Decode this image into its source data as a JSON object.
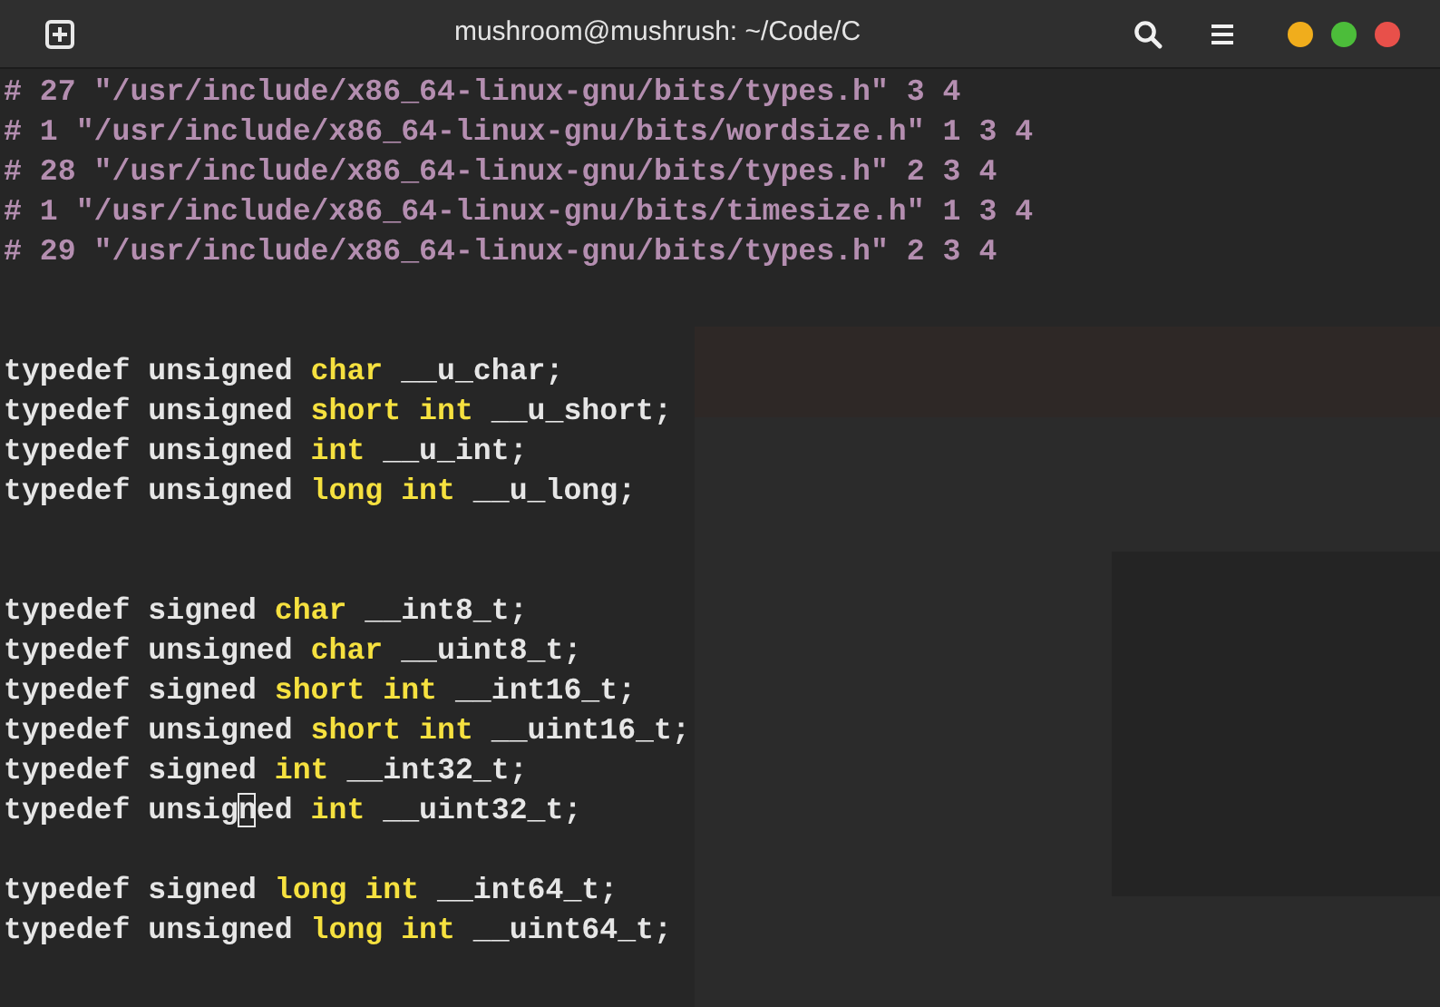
{
  "window": {
    "title": "mushroom@mushrush: ~/Code/C"
  },
  "window_controls": [
    {
      "color": "#f0ad1c"
    },
    {
      "color": "#4cbd3a"
    },
    {
      "color": "#e8504a"
    }
  ],
  "terminal": {
    "lines": [
      {
        "kind": "code",
        "segments": [
          {
            "kind": "directive",
            "text": "# 27 \"/usr/include/x86_64-linux-gnu/bits/types.h\" 3 4"
          }
        ]
      },
      {
        "kind": "code",
        "segments": [
          {
            "kind": "directive",
            "text": "# 1 \"/usr/include/x86_64-linux-gnu/bits/wordsize.h\" 1 3 4"
          }
        ]
      },
      {
        "kind": "code",
        "segments": [
          {
            "kind": "directive",
            "text": "# 28 \"/usr/include/x86_64-linux-gnu/bits/types.h\" 2 3 4"
          }
        ]
      },
      {
        "kind": "code",
        "segments": [
          {
            "kind": "directive",
            "text": "# 1 \"/usr/include/x86_64-linux-gnu/bits/timesize.h\" 1 3 4"
          }
        ]
      },
      {
        "kind": "code",
        "segments": [
          {
            "kind": "directive",
            "text": "# 29 \"/usr/include/x86_64-linux-gnu/bits/types.h\" 2 3 4"
          }
        ]
      },
      {
        "kind": "blank"
      },
      {
        "kind": "blank"
      },
      {
        "kind": "code",
        "segments": [
          {
            "kind": "plain",
            "text": "typedef unsigned "
          },
          {
            "kind": "type",
            "text": "char"
          },
          {
            "kind": "plain",
            "text": " __u_char;"
          }
        ]
      },
      {
        "kind": "code",
        "segments": [
          {
            "kind": "plain",
            "text": "typedef unsigned "
          },
          {
            "kind": "type",
            "text": "short int"
          },
          {
            "kind": "plain",
            "text": " __u_short;"
          }
        ]
      },
      {
        "kind": "code",
        "segments": [
          {
            "kind": "plain",
            "text": "typedef unsigned "
          },
          {
            "kind": "type",
            "text": "int"
          },
          {
            "kind": "plain",
            "text": " __u_int;"
          }
        ]
      },
      {
        "kind": "code",
        "segments": [
          {
            "kind": "plain",
            "text": "typedef unsigned "
          },
          {
            "kind": "type",
            "text": "long int"
          },
          {
            "kind": "plain",
            "text": " __u_long;"
          }
        ]
      },
      {
        "kind": "blank"
      },
      {
        "kind": "blank"
      },
      {
        "kind": "code",
        "segments": [
          {
            "kind": "plain",
            "text": "typedef signed "
          },
          {
            "kind": "type",
            "text": "char"
          },
          {
            "kind": "plain",
            "text": " __int8_t;"
          }
        ]
      },
      {
        "kind": "code",
        "segments": [
          {
            "kind": "plain",
            "text": "typedef unsigned "
          },
          {
            "kind": "type",
            "text": "char"
          },
          {
            "kind": "plain",
            "text": " __uint8_t;"
          }
        ]
      },
      {
        "kind": "code",
        "segments": [
          {
            "kind": "plain",
            "text": "typedef signed "
          },
          {
            "kind": "type",
            "text": "short int"
          },
          {
            "kind": "plain",
            "text": " __int16_t;"
          }
        ]
      },
      {
        "kind": "code",
        "segments": [
          {
            "kind": "plain",
            "text": "typedef unsigned "
          },
          {
            "kind": "type",
            "text": "short int"
          },
          {
            "kind": "plain",
            "text": " __uint16_t;"
          }
        ]
      },
      {
        "kind": "code",
        "segments": [
          {
            "kind": "plain",
            "text": "typedef signed "
          },
          {
            "kind": "type",
            "text": "int"
          },
          {
            "kind": "plain",
            "text": " __int32_t;"
          }
        ]
      },
      {
        "kind": "code",
        "segments": [
          {
            "kind": "plain",
            "text": "typedef unsig"
          },
          {
            "kind": "cursor",
            "text": "n"
          },
          {
            "kind": "plain",
            "text": "ed "
          },
          {
            "kind": "type",
            "text": "int"
          },
          {
            "kind": "plain",
            "text": " __uint32_t;"
          }
        ]
      },
      {
        "kind": "blank"
      },
      {
        "kind": "code",
        "segments": [
          {
            "kind": "plain",
            "text": "typedef signed "
          },
          {
            "kind": "type",
            "text": "long int"
          },
          {
            "kind": "plain",
            "text": " __int64_t;"
          }
        ]
      },
      {
        "kind": "code",
        "segments": [
          {
            "kind": "plain",
            "text": "typedef unsigned "
          },
          {
            "kind": "type",
            "text": "long int"
          },
          {
            "kind": "plain",
            "text": " __uint64_t;"
          }
        ]
      }
    ]
  }
}
